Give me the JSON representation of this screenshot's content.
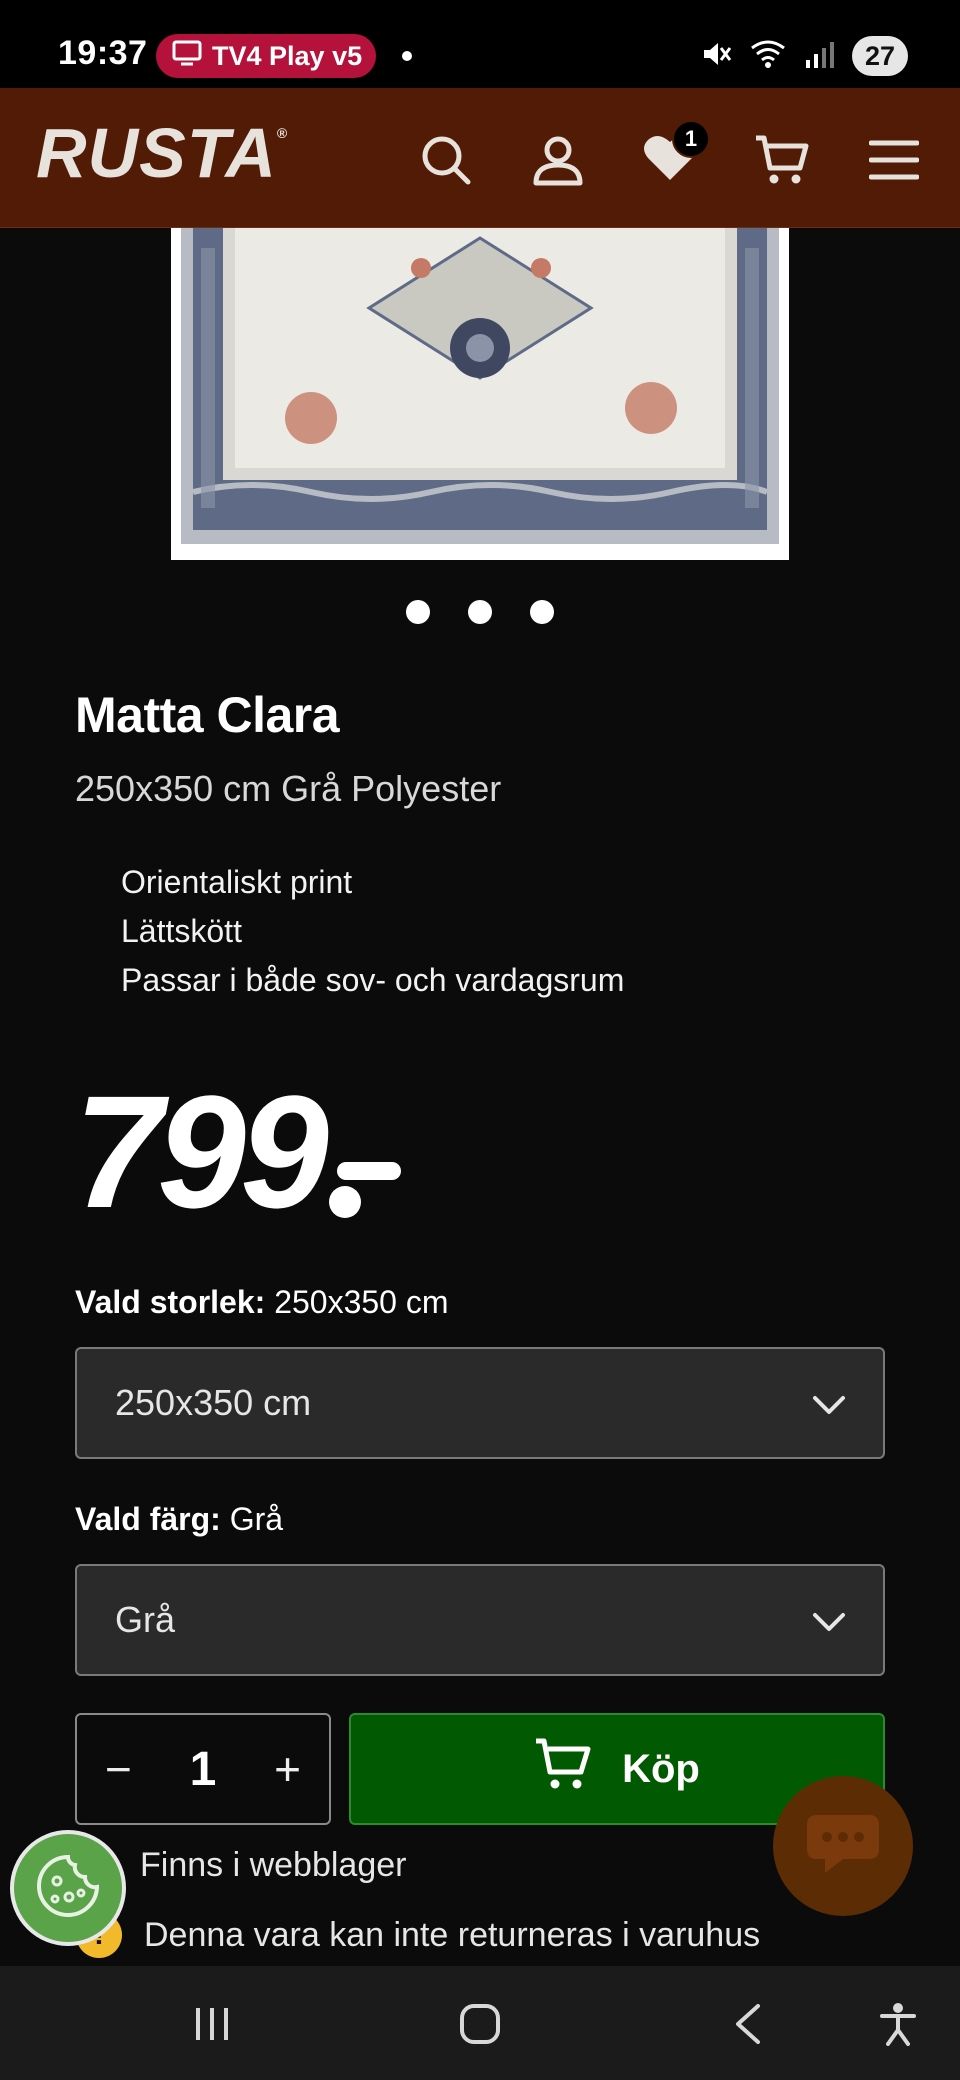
{
  "status_bar": {
    "time": "19:37",
    "notification_pill": "TV4 Play v5",
    "battery": "27",
    "icons": [
      "tv-icon",
      "mute-icon",
      "wifi-icon",
      "signal-icon"
    ]
  },
  "header": {
    "logo": "RUSTA",
    "wishlist_count": "1",
    "icons": [
      "search-icon",
      "account-icon",
      "heart-icon",
      "cart-icon",
      "menu-icon"
    ],
    "background_color": "#511b05"
  },
  "gallery": {
    "image_alt": "Matta Clara rug",
    "dots": 3
  },
  "product": {
    "title": "Matta Clara",
    "subtitle": "250x350 cm Grå Polyester",
    "features": [
      "Orientaliskt print",
      "Lättskött",
      "Passar i både sov- och vardagsrum"
    ],
    "price": "799"
  },
  "options": {
    "size": {
      "label": "Vald storlek:",
      "value_text": "250x350 cm",
      "selected": "250x350 cm"
    },
    "color": {
      "label": "Vald färg:",
      "value_text": "Grå",
      "selected": "Grå"
    }
  },
  "purchase": {
    "quantity": "1",
    "minus": "−",
    "plus": "+",
    "buy_label": "Köp",
    "buy_color": "#015a01"
  },
  "availability": {
    "stock_text": "Finns i webblager",
    "return_icon": "!",
    "return_text": "Denna vara kan inte returneras i varuhus"
  }
}
